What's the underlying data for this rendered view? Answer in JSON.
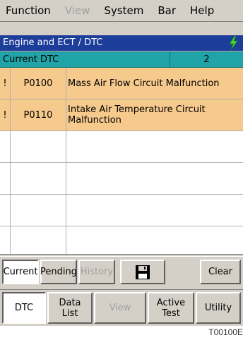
{
  "menu": {
    "items": [
      {
        "label": "Function",
        "enabled": true
      },
      {
        "label": "View",
        "enabled": false
      },
      {
        "label": "System",
        "enabled": true
      },
      {
        "label": "Bar",
        "enabled": true
      },
      {
        "label": "Help",
        "enabled": true
      }
    ]
  },
  "titlebar": {
    "title": "Engine and ECT / DTC",
    "icon": "plug-connected-icon",
    "color": "#1d3d9a"
  },
  "header": {
    "label": "Current DTC",
    "count": "2",
    "color": "#20a4a8"
  },
  "dtc_table": {
    "row_color": "#f6c98c",
    "rows": [
      {
        "flag": "!",
        "code": "P0100",
        "description": "Mass Air Flow Circuit Malfunction"
      },
      {
        "flag": "!",
        "code": "P0110",
        "description": "Intake Air Temperature Circuit Malfunction"
      },
      {
        "flag": "",
        "code": "",
        "description": ""
      },
      {
        "flag": "",
        "code": "",
        "description": ""
      },
      {
        "flag": "",
        "code": "",
        "description": ""
      }
    ]
  },
  "dtc_buttons": {
    "current": "Current",
    "pending": "Pending",
    "history": "History",
    "save_icon": "floppy-disk-icon",
    "clear": "Clear"
  },
  "bottom_tabs": {
    "dtc": "DTC",
    "data_list": "Data List",
    "view": "View",
    "active_test": "Active Test",
    "utility": "Utility"
  },
  "caption": "T00100E"
}
